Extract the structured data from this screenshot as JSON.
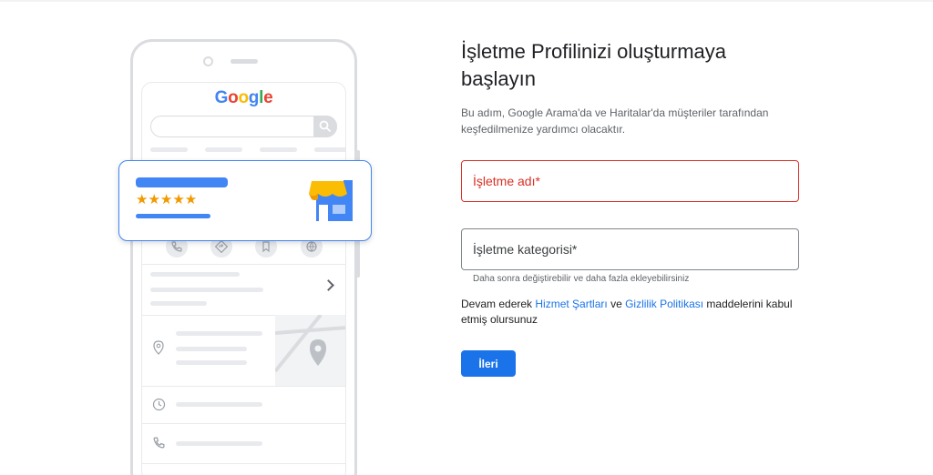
{
  "illustration": {
    "logo_parts": [
      "G",
      "o",
      "o",
      "g",
      "l",
      "e"
    ],
    "stars": "★★★★★",
    "colors": {
      "brand_blue": "#4285f4",
      "star_orange": "#f29900",
      "awning_yellow": "#fbbc04",
      "line_gray": "#e8eaed"
    },
    "action_icons": [
      "phone-icon",
      "directions-icon",
      "bookmark-icon",
      "globe-icon"
    ],
    "info_icons": [
      "location-pin-icon",
      "clock-icon",
      "phone-icon"
    ]
  },
  "form": {
    "title_line1": "İşletme Profilinizi oluşturmaya",
    "title_line2": "başlayın",
    "subtitle_line1": "Bu adım, Google Arama'da ve Haritalar'da müşteriler tarafından",
    "subtitle_line2": "keşfedilmenize yardımcı olacaktır.",
    "business_name": {
      "placeholder": "İşletme adı*",
      "value": "",
      "state": "error",
      "border_color": "#d93025"
    },
    "business_category": {
      "placeholder": "İşletme kategorisi*",
      "value": ""
    },
    "category_helper": "Daha sonra değiştirebilir ve daha fazla ekleyebilirsiniz",
    "terms": {
      "prefix": "Devam ederek ",
      "terms_link": "Hizmet Şartları",
      "and": " ve ",
      "privacy_link": "Gizlilik Politikası",
      "suffix": " maddelerini kabul etmiş olursunuz",
      "link_color": "#1a73e8"
    },
    "next_button": "İleri",
    "button_color": "#1a73e8"
  }
}
